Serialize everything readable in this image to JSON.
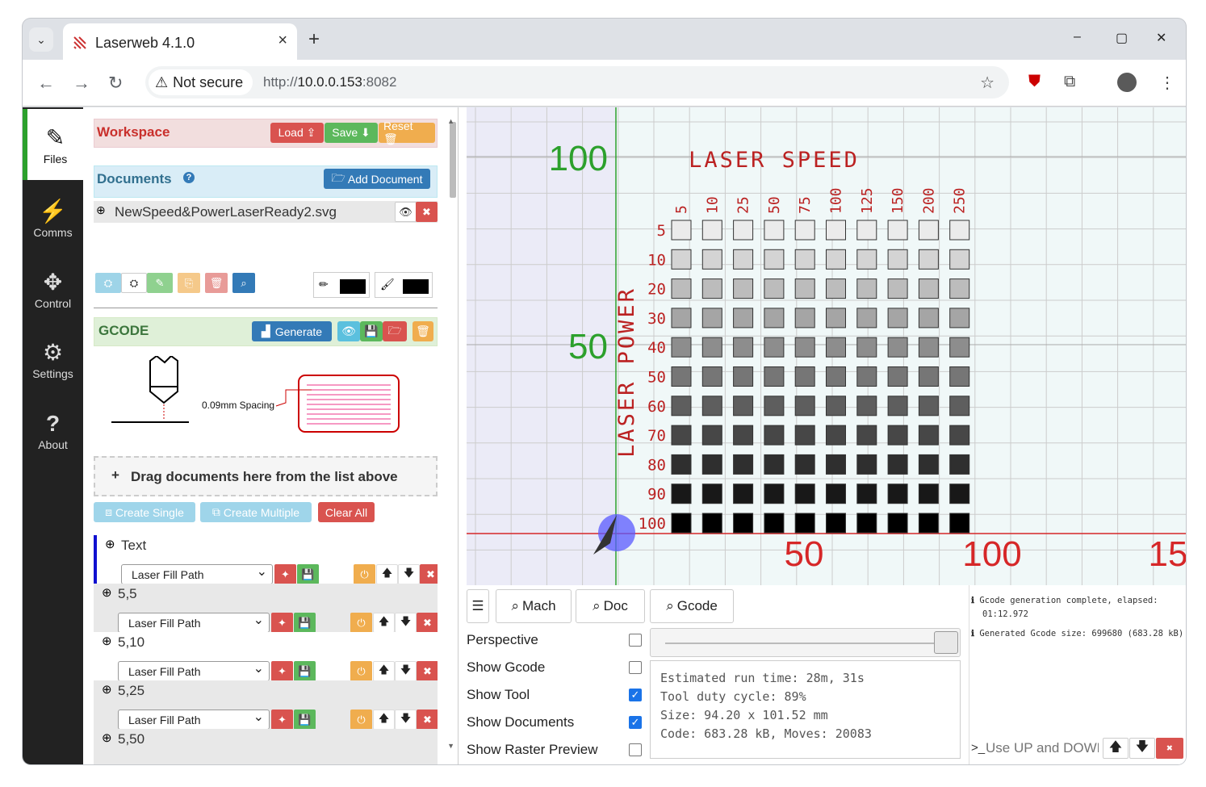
{
  "browser": {
    "tab_title": "Laserweb 4.1.0",
    "tab_close": "×",
    "new_tab": "+",
    "not_secure": "Not secure",
    "url_scheme": "http://",
    "url_host": "10.0.0.153",
    "url_port": ":8082",
    "win_min": "–",
    "win_max": "▢",
    "win_close": "✕"
  },
  "sidebar": [
    {
      "label": "Files",
      "icon": "edit-icon",
      "glyph": "✎"
    },
    {
      "label": "Comms",
      "icon": "plug-icon",
      "glyph": "⚡"
    },
    {
      "label": "Control",
      "icon": "move-icon",
      "glyph": "✥"
    },
    {
      "label": "Settings",
      "icon": "gears-icon",
      "glyph": "⚙"
    },
    {
      "label": "About",
      "icon": "question-icon",
      "glyph": "?"
    }
  ],
  "workspace": {
    "title": "Workspace",
    "load": "Load ⇪",
    "save": "Save ⬇",
    "reset": "Reset 🗑"
  },
  "documents": {
    "title": "Documents",
    "help": "?",
    "add": "Add Document",
    "file": "NewSpeed&PowerLaserReady2.svg"
  },
  "gcode": {
    "title": "GCODE",
    "generate": "Generate",
    "spacing": "0.09mm Spacing",
    "drop_hint": "Drag documents here from the list above",
    "create_single": "Create Single",
    "create_multiple": "Create Multiple",
    "clear_all": "Clear All"
  },
  "operations": [
    {
      "name": "Text",
      "type": "Laser Fill Path"
    },
    {
      "name": "5,5",
      "type": "Laser Fill Path"
    },
    {
      "name": "5,10",
      "type": "Laser Fill Path"
    },
    {
      "name": "5,25",
      "type": "Laser Fill Path"
    },
    {
      "name": "5,50",
      "type": ""
    }
  ],
  "viewer": {
    "y_labels": [
      "100",
      "50"
    ],
    "x_labels": [
      "50",
      "100",
      "15"
    ],
    "title": "LASER SPEED",
    "power_label": "LASER POWER",
    "speeds": [
      "5",
      "10",
      "25",
      "50",
      "75",
      "100",
      "125",
      "150",
      "200",
      "250"
    ],
    "powers": [
      "5",
      "10",
      "20",
      "30",
      "40",
      "50",
      "60",
      "70",
      "80",
      "90",
      "100"
    ]
  },
  "toolbar": {
    "mach": "Mach",
    "doc": "Doc",
    "gcode": "Gcode"
  },
  "options": [
    {
      "label": "Perspective",
      "checked": false
    },
    {
      "label": "Show Gcode",
      "checked": false
    },
    {
      "label": "Show Tool",
      "checked": true
    },
    {
      "label": "Show Documents",
      "checked": true
    },
    {
      "label": "Show Raster Preview",
      "checked": false
    }
  ],
  "stats": {
    "run_time": "Estimated run time: 28m, 31s",
    "duty": "Tool duty cycle: 89%",
    "size": "Size: 94.20 x 101.52 mm",
    "code": "Code: 683.28 kB, Moves: 20083"
  },
  "log": {
    "line1": "Gcode generation complete, elapsed:",
    "line1b": "01:12.972",
    "line2": "Generated Gcode size: 699680 (683.28 kB)",
    "cmd_placeholder": "Use UP and DOWN"
  },
  "colors": {
    "accent_green": "#2ca02c",
    "axis_red": "#d62728",
    "axis_green": "#2ca02c"
  }
}
